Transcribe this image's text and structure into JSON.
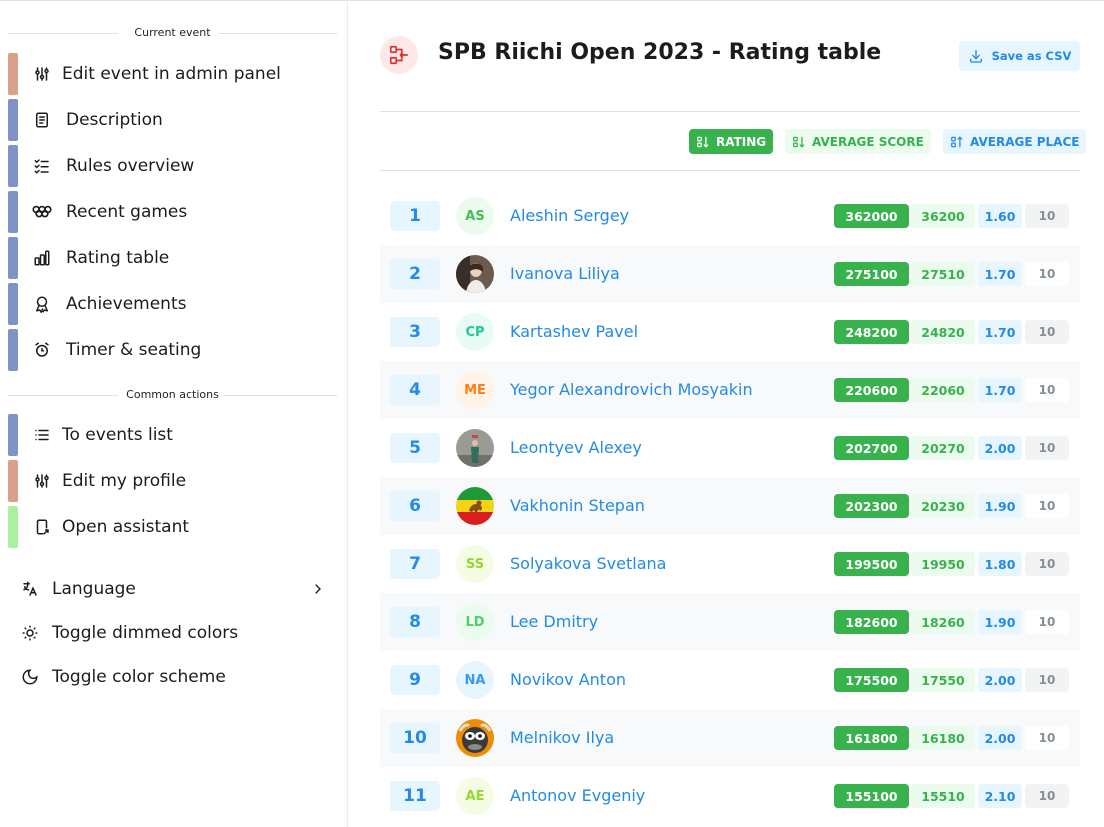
{
  "sidebar": {
    "current_event_label": "Current event",
    "common_actions_label": "Common actions",
    "event_items": [
      {
        "label": "Edit event in admin panel",
        "icon": "sliders-icon",
        "bar_color": "#d9a08a"
      },
      {
        "label": "Description",
        "icon": "document-icon",
        "bar_color": "#8093c7"
      },
      {
        "label": "Rules overview",
        "icon": "checklist-icon",
        "bar_color": "#8093c7"
      },
      {
        "label": "Recent games",
        "icon": "olympic-rings-icon",
        "bar_color": "#8093c7"
      },
      {
        "label": "Rating table",
        "icon": "bar-chart-icon",
        "bar_color": "#8093c7"
      },
      {
        "label": "Achievements",
        "icon": "award-icon",
        "bar_color": "#8093c7"
      },
      {
        "label": "Timer & seating",
        "icon": "alarm-clock-icon",
        "bar_color": "#8093c7"
      }
    ],
    "common_items": [
      {
        "label": "To events list",
        "icon": "list-icon",
        "bar_color": "#8093c7"
      },
      {
        "label": "Edit my profile",
        "icon": "sliders-icon",
        "bar_color": "#d9a08a"
      },
      {
        "label": "Open assistant",
        "icon": "device-arrow-icon",
        "bar_color": "#a9f0a0"
      }
    ],
    "settings": [
      {
        "label": "Language",
        "icon": "translate-icon"
      },
      {
        "label": "Toggle dimmed colors",
        "icon": "sun-icon"
      },
      {
        "label": "Toggle color scheme",
        "icon": "moon-icon"
      }
    ]
  },
  "header": {
    "title": "SPB Riichi Open 2023 - Rating table",
    "save_csv_label": "Save as CSV"
  },
  "sort": {
    "rating_label": "RATING",
    "score_label": "AVERAGE SCORE",
    "place_label": "AVERAGE PLACE",
    "active": "rating"
  },
  "players": [
    {
      "rank": "1",
      "name": "Aleshin Sergey",
      "initials": "AS",
      "avatar_bg": "#ebfbee",
      "avatar_fg": "#40c057",
      "rating": "362000",
      "avg_score": "36200",
      "avg_place": "1.60",
      "games": "10"
    },
    {
      "rank": "2",
      "name": "Ivanova Liliya",
      "initials": "",
      "avatar_photo": "photo-portrait",
      "rating": "275100",
      "avg_score": "27510",
      "avg_place": "1.70",
      "games": "10"
    },
    {
      "rank": "3",
      "name": "Kartashev Pavel",
      "initials": "CP",
      "avatar_bg": "#e6fcf5",
      "avatar_fg": "#20c997",
      "rating": "248200",
      "avg_score": "24820",
      "avg_place": "1.70",
      "games": "10"
    },
    {
      "rank": "4",
      "name": "Yegor Alexandrovich Mosyakin",
      "initials": "ME",
      "avatar_bg": "#fff4e6",
      "avatar_fg": "#fd7e14",
      "rating": "220600",
      "avg_score": "22060",
      "avg_place": "1.70",
      "games": "10"
    },
    {
      "rank": "5",
      "name": "Leontyev Alexey",
      "initials": "",
      "avatar_photo": "photo-figure",
      "rating": "202700",
      "avg_score": "20270",
      "avg_place": "2.00",
      "games": "10"
    },
    {
      "rank": "6",
      "name": "Vakhonin Stepan",
      "initials": "",
      "avatar_photo": "flag-lion",
      "rating": "202300",
      "avg_score": "20230",
      "avg_place": "1.90",
      "games": "10"
    },
    {
      "rank": "7",
      "name": "Solyakova Svetlana",
      "initials": "SS",
      "avatar_bg": "#f4fce3",
      "avatar_fg": "#94d82d",
      "rating": "199500",
      "avg_score": "19950",
      "avg_place": "1.80",
      "games": "10"
    },
    {
      "rank": "8",
      "name": "Lee Dmitry",
      "initials": "LD",
      "avatar_bg": "#ebfbee",
      "avatar_fg": "#51cf66",
      "rating": "182600",
      "avg_score": "18260",
      "avg_place": "1.90",
      "games": "10"
    },
    {
      "rank": "9",
      "name": "Novikov Anton",
      "initials": "NA",
      "avatar_bg": "#e7f5ff",
      "avatar_fg": "#339af0",
      "rating": "175500",
      "avg_score": "17550",
      "avg_place": "2.00",
      "games": "10"
    },
    {
      "rank": "10",
      "name": "Melnikov Ilya",
      "initials": "",
      "avatar_photo": "cartoon-sheep",
      "rating": "161800",
      "avg_score": "16180",
      "avg_place": "2.00",
      "games": "10"
    },
    {
      "rank": "11",
      "name": "Antonov Evgeniy",
      "initials": "AE",
      "avatar_bg": "#f4fce3",
      "avatar_fg": "#94d82d",
      "rating": "155100",
      "avg_score": "15510",
      "avg_place": "2.10",
      "games": "10"
    }
  ]
}
